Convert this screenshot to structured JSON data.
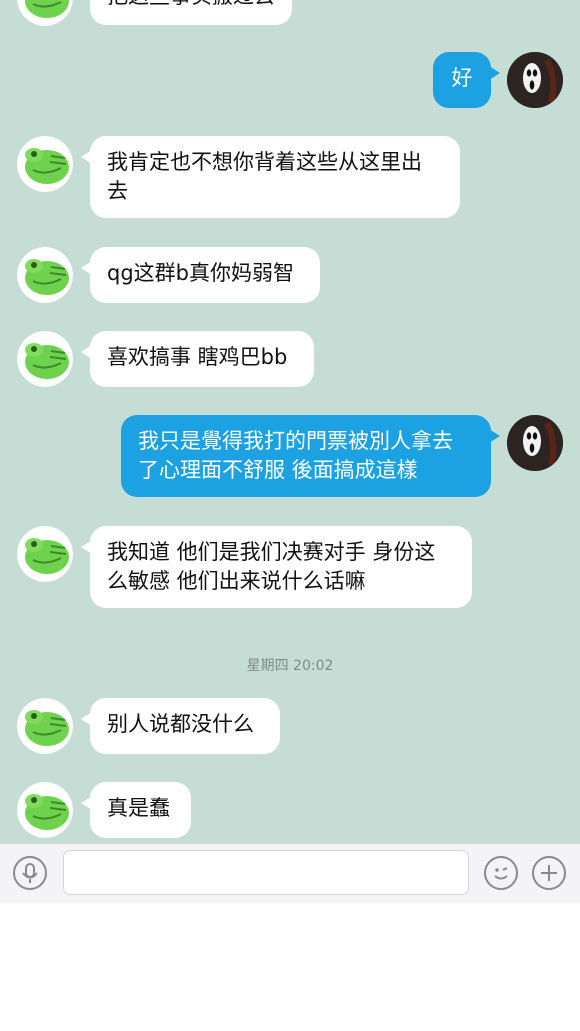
{
  "chat": {
    "messages": [
      {
        "side": "in",
        "text": "把这些事实搬过去"
      },
      {
        "side": "out",
        "text": "好"
      },
      {
        "side": "in",
        "text": "我肯定也不想你背着这些从这里出\n去"
      },
      {
        "side": "in",
        "text": "qg这群b真你妈弱智"
      },
      {
        "side": "in",
        "text": "喜欢搞事 瞎鸡巴bb"
      },
      {
        "side": "out",
        "text": "我只是覺得我打的門票被別人拿去\n了心理面不舒服 後面搞成這樣"
      },
      {
        "side": "in",
        "text": "我知道 他们是我们决赛对手 身份这\n么敏感 他们出来说什么话嘛"
      },
      {
        "side": "in",
        "text": "别人说都没什么"
      },
      {
        "side": "in",
        "text": "真是蠢"
      }
    ],
    "timestamp": "星期四 20:02"
  },
  "input_bar": {
    "value": "",
    "voice_icon": "microphone-icon",
    "emoji_icon": "emoji-icon",
    "plus_icon": "plus-icon"
  },
  "colors": {
    "chat_background": "#c6ddd6",
    "incoming_bubble": "#ffffff",
    "outgoing_bubble": "#1ca2e2"
  }
}
